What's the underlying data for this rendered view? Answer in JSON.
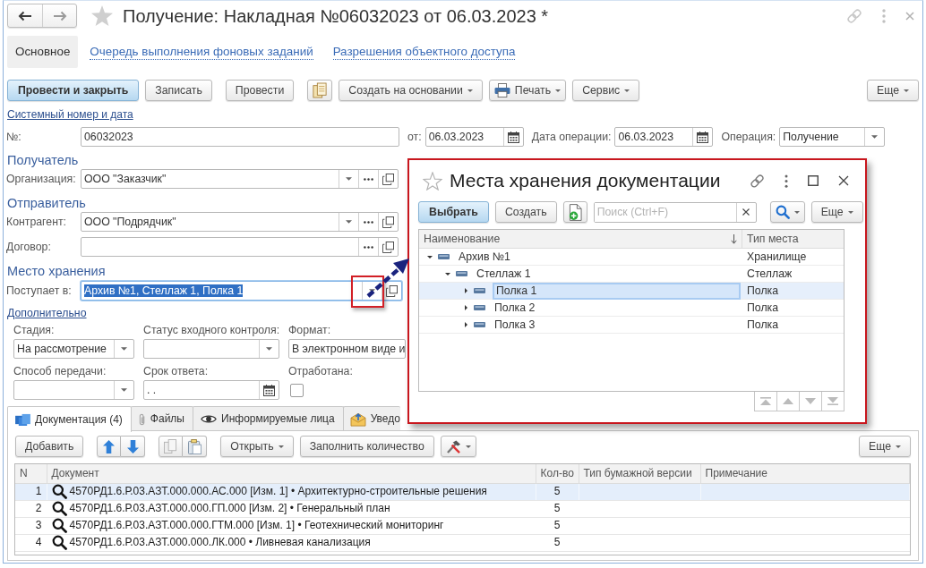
{
  "window": {
    "title": "Получение: Накладная №06032023 от 06.03.2023 *"
  },
  "form_tabs": [
    {
      "label": "Основное",
      "selected": true
    },
    {
      "label": "Очередь выполнения фоновых заданий",
      "selected": false
    },
    {
      "label": "Разрешения объектного доступа",
      "selected": false
    }
  ],
  "toolbar": {
    "post_and_close": "Провести и закрыть",
    "save": "Записать",
    "post": "Провести",
    "create_based_on": "Создать на основании",
    "print": "Печать",
    "service": "Сервис",
    "more": "Еще"
  },
  "system_number_link": "Системный номер и дата",
  "header_fields": {
    "number": {
      "label": "№:",
      "value": "06032023"
    },
    "date": {
      "label": "от:",
      "value": "06.03.2023"
    },
    "operation_date": {
      "label": "Дата операции:",
      "value": "06.03.2023"
    },
    "operation": {
      "label": "Операция:",
      "value": "Получение"
    }
  },
  "recipient": {
    "heading": "Получатель",
    "organization": {
      "label": "Организация:",
      "value": "ООО \"Заказчик\""
    }
  },
  "sender": {
    "heading": "Отправитель",
    "counterparty": {
      "label": "Контрагент:",
      "value": "ООО \"Подрядчик\""
    },
    "contract": {
      "label": "Договор:"
    }
  },
  "storage": {
    "heading": "Место хранения",
    "arrives_to": {
      "label": "Поступает в:",
      "value": "Архив №1, Стеллаж 1, Полка 1",
      "focused": true
    }
  },
  "additional": {
    "link": "Дополнительно",
    "fields": [
      {
        "kind": "select",
        "label": "Стадия:",
        "value": "На рассмотрение"
      },
      {
        "kind": "select",
        "label": "Статус входного контроля:"
      },
      {
        "kind": "text",
        "label": "Формат:",
        "value": "В электронном виде и"
      },
      {
        "kind": "select",
        "label": "Способ передачи:"
      },
      {
        "kind": "date",
        "label": "Срок ответа:",
        "value": ". ."
      },
      {
        "kind": "checkbox",
        "label": "Отработана:",
        "checked": false
      }
    ]
  },
  "document_tabs": [
    {
      "label": "Документация (4)",
      "selected": true
    },
    {
      "label": "Файлы",
      "selected": false
    },
    {
      "label": "Информируемые лица",
      "selected": false
    },
    {
      "label": "Уведо",
      "selected": false
    }
  ],
  "documents_toolbar": {
    "add": "Добавить",
    "open": "Открыть",
    "fill_quantity": "Заполнить количество",
    "more": "Еще"
  },
  "documents_table": {
    "columns": [
      "N",
      "Документ",
      "Кол-во",
      "Тип бумажной версии",
      "Примечание"
    ],
    "rows": [
      {
        "n": "1",
        "document": "4570РД1.6.Р.03.АЗТ.000.000.АС.000 [Изм. 1] • Архитектурно-строительные решения",
        "quantity": "5",
        "selected": true
      },
      {
        "n": "2",
        "document": "4570РД1.6.Р.03.АЗТ.000.000.ГП.000 [Изм. 2] • Генеральный план",
        "quantity": "5",
        "selected": false
      },
      {
        "n": "3",
        "document": "4570РД1.6.Р.03.АЗТ.000.000.ГТМ.000 [Изм. 1] • Геотехнический мониторинг",
        "quantity": "5",
        "selected": false
      },
      {
        "n": "4",
        "document": "4570РД1.6.Р.03.АЗТ.000.000.ЛК.000 • Ливневая канализация",
        "quantity": "5",
        "selected": false
      }
    ]
  },
  "storage_picker": {
    "title": "Места хранения документации",
    "select": "Выбрать",
    "create": "Создать",
    "search": {
      "placeholder": "Поиск (Ctrl+F)"
    },
    "more": "Еще",
    "columns": [
      "Наименование",
      "Тип места"
    ],
    "tree": [
      {
        "name": "Архив №1",
        "type": "Хранилище",
        "expanded": true,
        "selected": false,
        "children": [
          {
            "name": "Стеллаж 1",
            "type": "Стеллаж",
            "expanded": true,
            "selected": false,
            "children": [
              {
                "name": "Полка 1",
                "type": "Полка",
                "expanded": false,
                "selected": true
              },
              {
                "name": "Полка 2",
                "type": "Полка",
                "expanded": false,
                "selected": false
              },
              {
                "name": "Полка 3",
                "type": "Полка",
                "expanded": false,
                "selected": false
              }
            ]
          }
        ]
      }
    ]
  }
}
